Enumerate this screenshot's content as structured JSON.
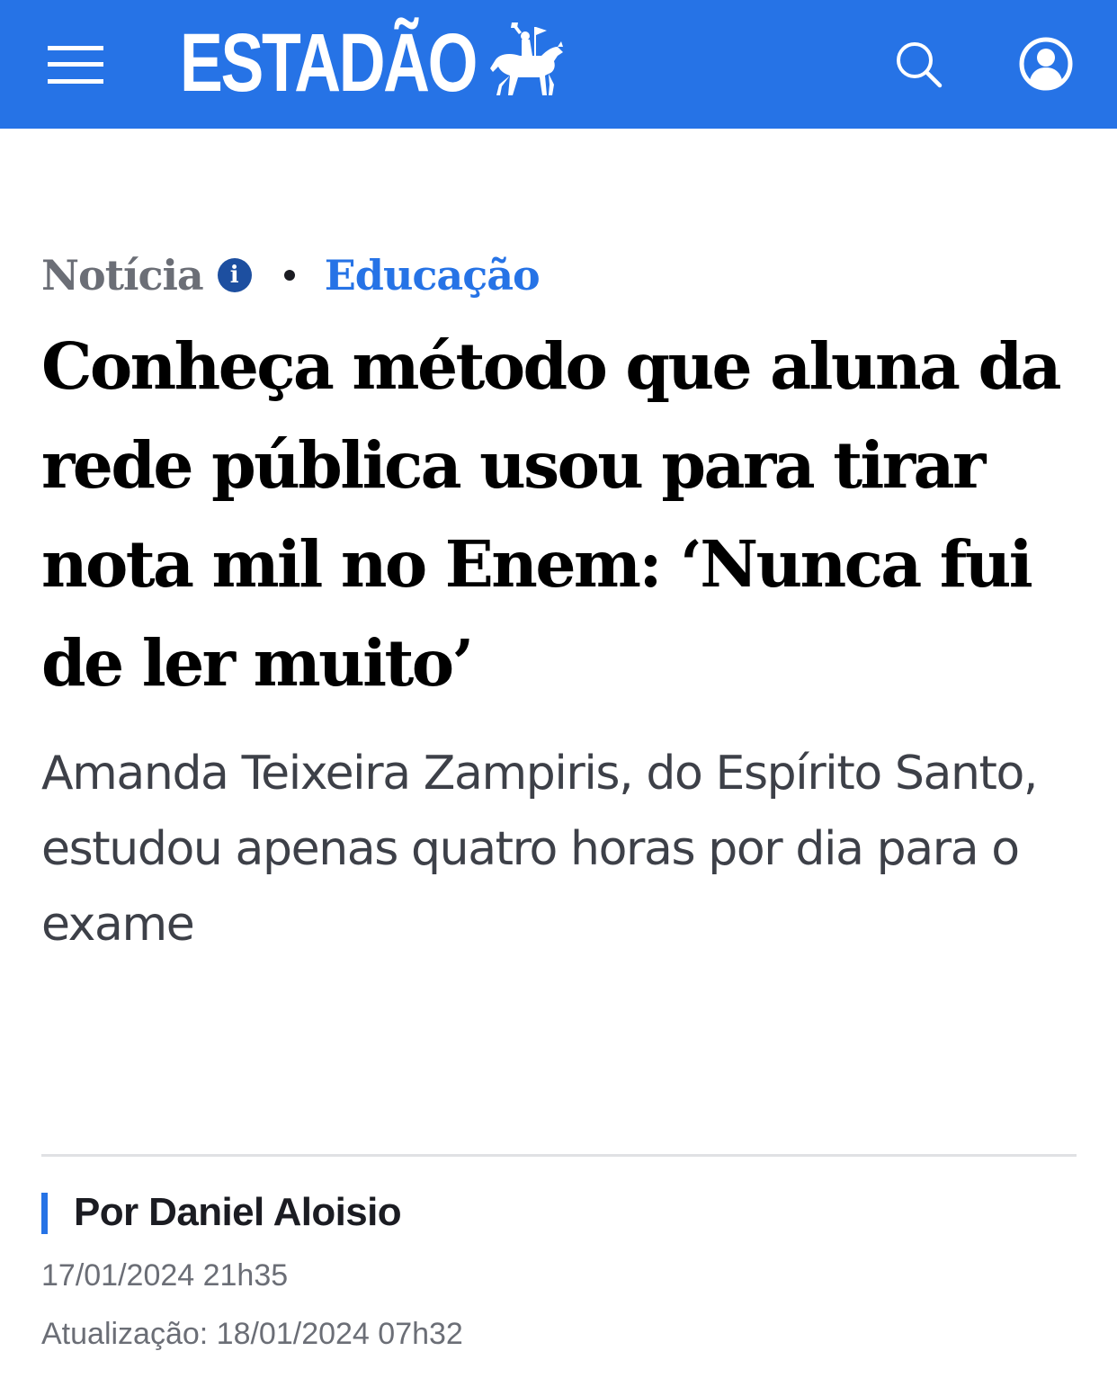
{
  "header": {
    "logo_text": "ESTADÃO",
    "menu_icon": "hamburger-menu-icon",
    "logo_icon": "horseman-trumpet-icon",
    "search_icon": "search-icon",
    "user_icon": "user-account-icon",
    "background_color": "#2673e6"
  },
  "article": {
    "kicker_type": "Notícia",
    "kicker_info": "i",
    "kicker_section": "Educação",
    "headline": "Conheça método que aluna da rede pública usou para tirar nota mil no Enem: ‘Nunca fui de ler muito’",
    "subtitle": "Amanda Teixeira Zampiris, do Espírito Santo, estudou apenas quatro horas por dia para o exame",
    "author": "Por Daniel Aloisio",
    "published": "17/01/2024 21h35",
    "updated": "Atualização: 18/01/2024 07h32"
  },
  "colors": {
    "accent": "#2673e6",
    "info_badge": "#1d4fa0",
    "muted_text": "#6b6e76"
  }
}
